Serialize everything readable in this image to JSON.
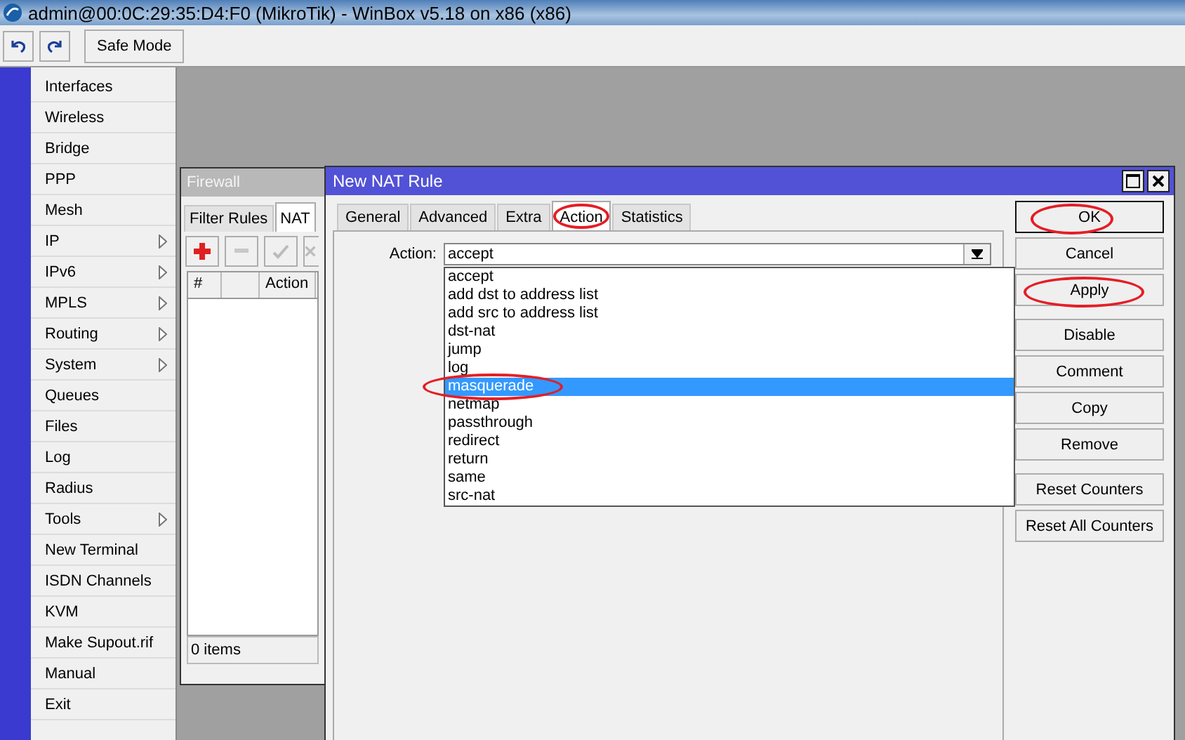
{
  "title_bar": {
    "title": "admin@00:0C:29:35:D4:F0 (MikroTik) - WinBox v5.18 on x86 (x86)"
  },
  "toolbar": {
    "safe_mode": "Safe Mode"
  },
  "sidebar": {
    "items": [
      {
        "label": "Interfaces",
        "submenu": false
      },
      {
        "label": "Wireless",
        "submenu": false
      },
      {
        "label": "Bridge",
        "submenu": false
      },
      {
        "label": "PPP",
        "submenu": false
      },
      {
        "label": "Mesh",
        "submenu": false
      },
      {
        "label": "IP",
        "submenu": true
      },
      {
        "label": "IPv6",
        "submenu": true
      },
      {
        "label": "MPLS",
        "submenu": true
      },
      {
        "label": "Routing",
        "submenu": true
      },
      {
        "label": "System",
        "submenu": true
      },
      {
        "label": "Queues",
        "submenu": false
      },
      {
        "label": "Files",
        "submenu": false
      },
      {
        "label": "Log",
        "submenu": false
      },
      {
        "label": "Radius",
        "submenu": false
      },
      {
        "label": "Tools",
        "submenu": true
      },
      {
        "label": "New Terminal",
        "submenu": false
      },
      {
        "label": "ISDN Channels",
        "submenu": false
      },
      {
        "label": "KVM",
        "submenu": false
      },
      {
        "label": "Make Supout.rif",
        "submenu": false
      },
      {
        "label": "Manual",
        "submenu": false
      },
      {
        "label": "Exit",
        "submenu": false
      }
    ]
  },
  "firewall": {
    "title": "Firewall",
    "tabs": [
      {
        "label": "Filter Rules",
        "selected": false
      },
      {
        "label": "NAT",
        "selected": true
      }
    ],
    "columns": [
      "#",
      "Action"
    ],
    "status": "0 items"
  },
  "nat_rule": {
    "title": "New NAT Rule",
    "tabs": [
      {
        "label": "General",
        "selected": false,
        "circled": false
      },
      {
        "label": "Advanced",
        "selected": false,
        "circled": false
      },
      {
        "label": "Extra",
        "selected": false,
        "circled": false
      },
      {
        "label": "Action",
        "selected": true,
        "circled": true
      },
      {
        "label": "Statistics",
        "selected": false,
        "circled": false
      }
    ],
    "action_label": "Action:",
    "action_value": "accept",
    "options": [
      {
        "label": "accept",
        "selected": false,
        "circled": false
      },
      {
        "label": "add dst to address list",
        "selected": false,
        "circled": false
      },
      {
        "label": "add src to address list",
        "selected": false,
        "circled": false
      },
      {
        "label": "dst-nat",
        "selected": false,
        "circled": false
      },
      {
        "label": "jump",
        "selected": false,
        "circled": false
      },
      {
        "label": "log",
        "selected": false,
        "circled": false
      },
      {
        "label": "masquerade",
        "selected": true,
        "circled": true
      },
      {
        "label": "netmap",
        "selected": false,
        "circled": false
      },
      {
        "label": "passthrough",
        "selected": false,
        "circled": false
      },
      {
        "label": "redirect",
        "selected": false,
        "circled": false
      },
      {
        "label": "return",
        "selected": false,
        "circled": false
      },
      {
        "label": "same",
        "selected": false,
        "circled": false
      },
      {
        "label": "src-nat",
        "selected": false,
        "circled": false
      }
    ],
    "button_groups": [
      [
        {
          "label": "OK",
          "default": true,
          "circled": true
        },
        {
          "label": "Cancel",
          "default": false,
          "circled": false
        },
        {
          "label": "Apply",
          "default": false,
          "circled": true
        }
      ],
      [
        {
          "label": "Disable",
          "default": false,
          "circled": false
        },
        {
          "label": "Comment",
          "default": false,
          "circled": false
        },
        {
          "label": "Copy",
          "default": false,
          "circled": false
        },
        {
          "label": "Remove",
          "default": false,
          "circled": false
        }
      ],
      [
        {
          "label": "Reset Counters",
          "default": false,
          "circled": false
        },
        {
          "label": "Reset All Counters",
          "default": false,
          "circled": false
        }
      ]
    ]
  }
}
